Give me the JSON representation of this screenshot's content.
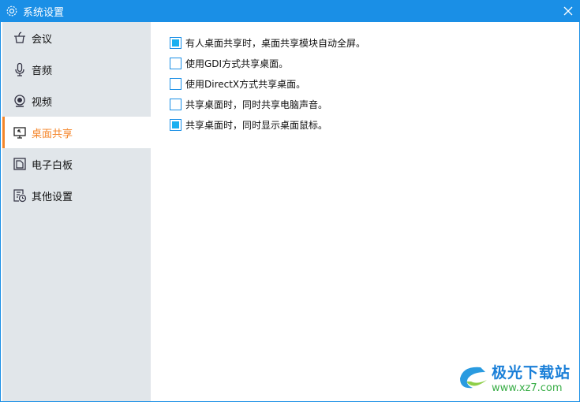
{
  "window": {
    "title": "系统设置"
  },
  "sidebar": {
    "items": [
      {
        "label": "会议",
        "icon": "meeting-icon"
      },
      {
        "label": "音频",
        "icon": "microphone-icon"
      },
      {
        "label": "视频",
        "icon": "camera-icon"
      },
      {
        "label": "桌面共享",
        "icon": "screen-share-icon",
        "active": true
      },
      {
        "label": "电子白板",
        "icon": "whiteboard-icon"
      },
      {
        "label": "其他设置",
        "icon": "other-settings-icon"
      }
    ]
  },
  "options": [
    {
      "label": "有人桌面共享时，桌面共享模块自动全屏。",
      "checked": true
    },
    {
      "label": "使用GDI方式共享桌面。",
      "checked": false
    },
    {
      "label": "使用DirectX方式共享桌面。",
      "checked": false
    },
    {
      "label": "共享桌面时，同时共享电脑声音。",
      "checked": false
    },
    {
      "label": "共享桌面时，同时显示桌面鼠标。",
      "checked": true
    }
  ],
  "watermark": {
    "name": "极光下载站",
    "url": "www.xz7.com"
  },
  "colors": {
    "accent": "#1a8fe6",
    "active": "#f5862a",
    "sidebar": "#e1e6ea"
  }
}
